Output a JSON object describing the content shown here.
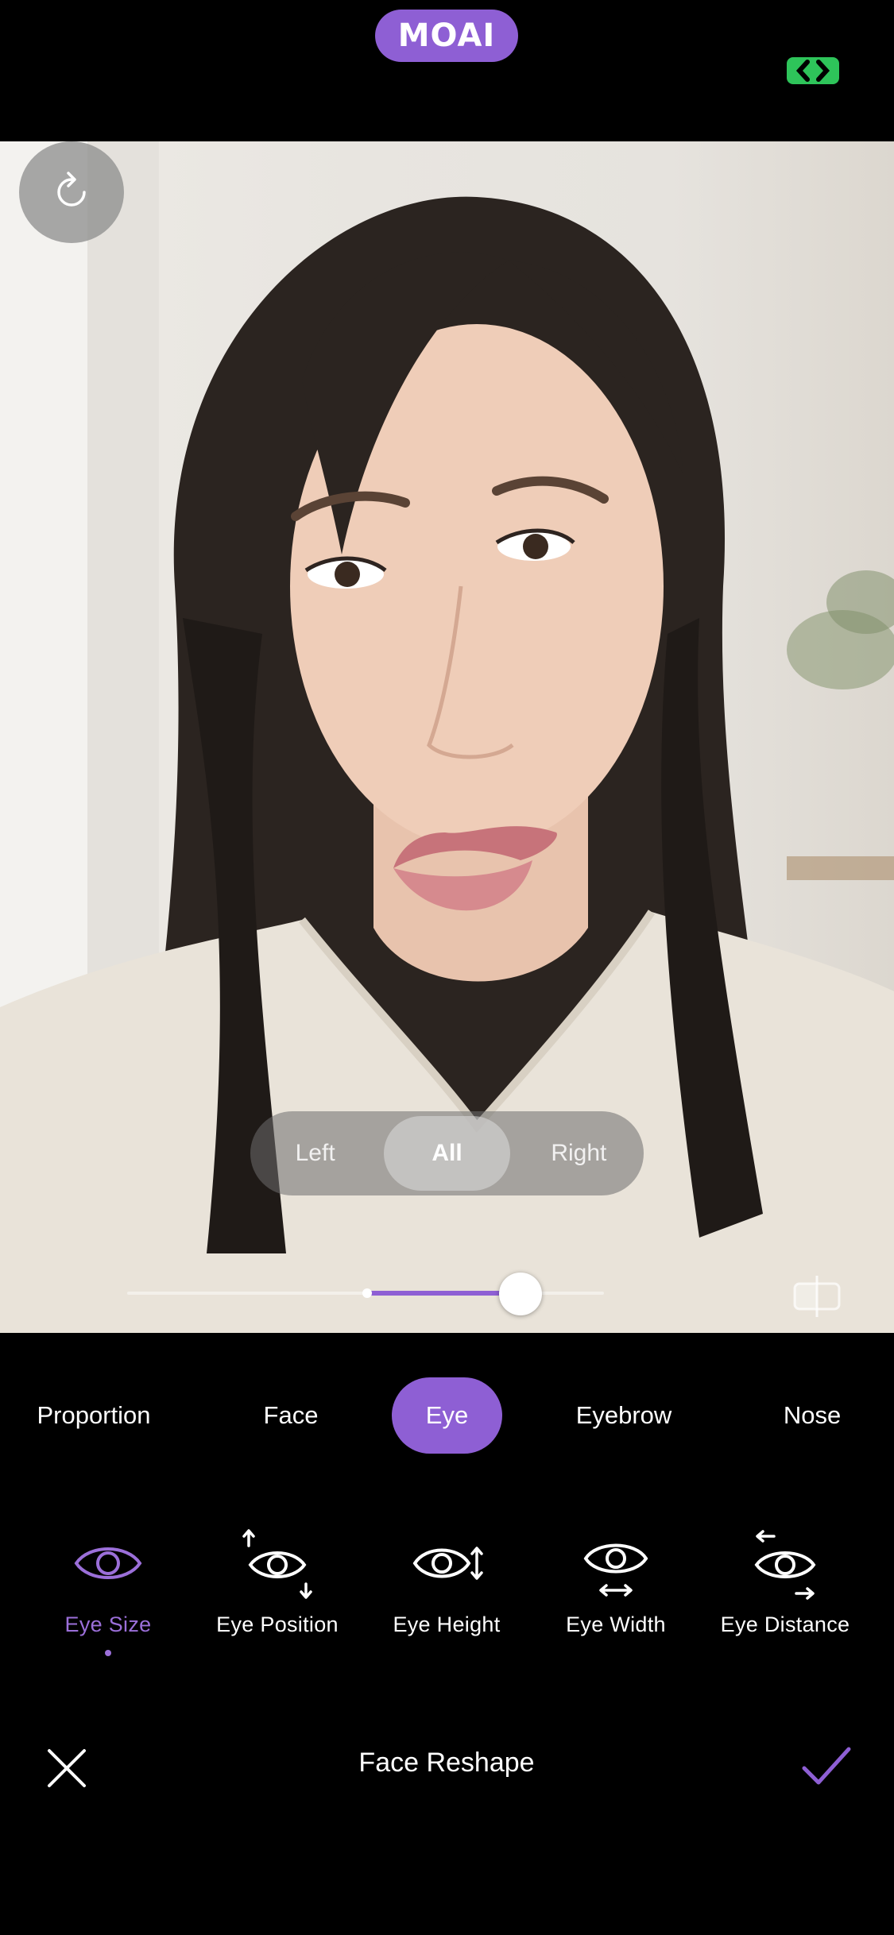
{
  "app": {
    "logo_text": "MOAI"
  },
  "colors": {
    "accent": "#8e5fd4",
    "accent_light": "#9b6fd9",
    "ar_badge": "#2ec45a"
  },
  "icons": {
    "ar": "ar-badge-icon",
    "reset": "refresh-icon",
    "compare": "compare-icon",
    "close": "close-icon",
    "confirm": "checkmark-icon"
  },
  "side_selector": {
    "options": [
      "Left",
      "All",
      "Right"
    ],
    "selected": "All"
  },
  "intensity_slider": {
    "min": -100,
    "max": 100,
    "value": 65
  },
  "categories": {
    "items": [
      "Proportion",
      "Face",
      "Eye",
      "Eyebrow",
      "Nose"
    ],
    "selected": "Eye"
  },
  "tools": {
    "items": [
      {
        "label": "Eye Size",
        "icon": "eye-size-icon"
      },
      {
        "label": "Eye Position",
        "icon": "eye-position-icon"
      },
      {
        "label": "Eye Height",
        "icon": "eye-height-icon"
      },
      {
        "label": "Eye Width",
        "icon": "eye-width-icon"
      },
      {
        "label": "Eye Distance",
        "icon": "eye-distance-icon"
      }
    ],
    "selected": "Eye Size"
  },
  "bottom_bar": {
    "title": "Face Reshape"
  }
}
